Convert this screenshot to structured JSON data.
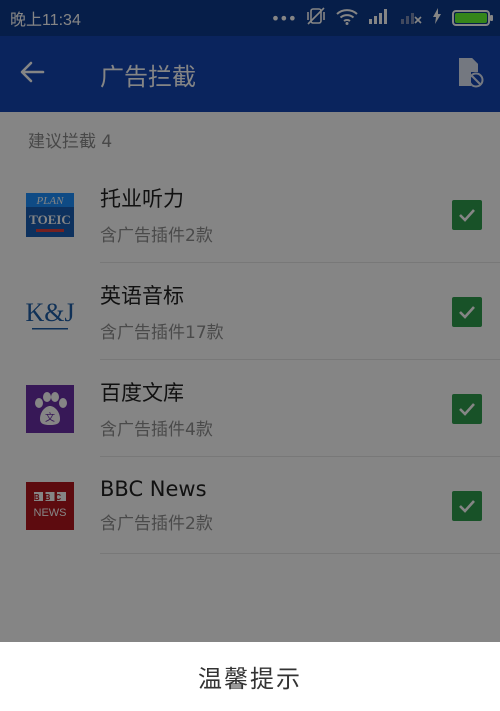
{
  "status_bar": {
    "time": "晚上11:34",
    "dots": "•••",
    "icons": [
      "mute-vibrate-icon",
      "wifi-icon",
      "signal-icon",
      "signal-no-sim-icon",
      "charging-bolt-icon",
      "battery-icon"
    ]
  },
  "app_bar": {
    "title": "广告拦截",
    "back_icon": "back-arrow-icon",
    "action_icon": "file-block-icon"
  },
  "section": {
    "header": "建议拦截 4"
  },
  "items": [
    {
      "name": "托业听力",
      "subtitle": "含广告插件2款",
      "icon": "toeic-icon",
      "icon_text_top": "PLAN",
      "icon_text_main": "TOEIC",
      "checked": true
    },
    {
      "name": "英语音标",
      "subtitle": "含广告插件17款",
      "icon": "kj-icon",
      "icon_text_main": "K&J",
      "checked": true
    },
    {
      "name": "百度文库",
      "subtitle": "含广告插件4款",
      "icon": "baidu-wenku-icon",
      "icon_text_main": "文",
      "checked": true
    },
    {
      "name": "BBC News",
      "subtitle": "含广告插件2款",
      "icon": "bbc-news-icon",
      "icon_text_top": "BBC",
      "icon_text_main": "NEWS",
      "checked": true
    }
  ],
  "dialog": {
    "title": "温馨提示"
  },
  "colors": {
    "status_bar": "#0d3a8c",
    "app_bar": "#1446b3",
    "checkbox": "#2e9d4e",
    "battery": "#66ff33",
    "scrim": "rgba(0,0,0,0.48)"
  }
}
